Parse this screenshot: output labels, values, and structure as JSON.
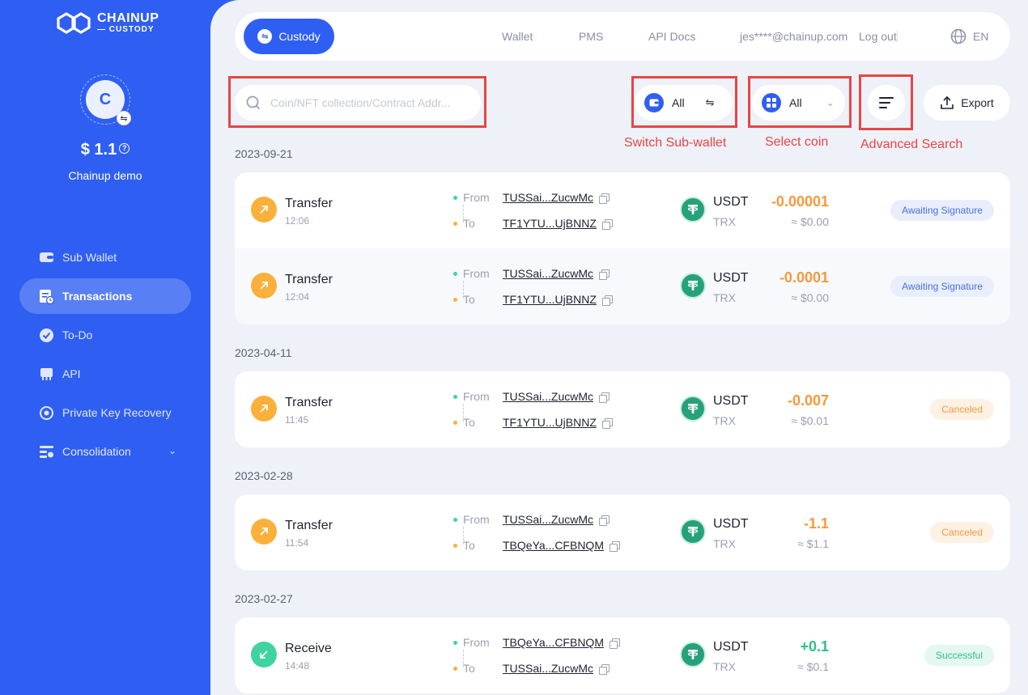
{
  "brand": {
    "name": "CHAINUP",
    "sub": "— CUSTODY"
  },
  "account": {
    "avatar_letter": "C",
    "balance": "$ 1.1",
    "name": "Chainup demo"
  },
  "nav": [
    {
      "label": "Sub Wallet",
      "icon": "wallet-icon"
    },
    {
      "label": "Transactions",
      "icon": "transactions-icon",
      "active": true
    },
    {
      "label": "To-Do",
      "icon": "check-circle-icon"
    },
    {
      "label": "API",
      "icon": "api-icon"
    },
    {
      "label": "Private Key Recovery",
      "icon": "key-recovery-icon"
    },
    {
      "label": "Consolidation",
      "icon": "consolidation-icon",
      "has_chevron": true
    }
  ],
  "topbar": {
    "custody_label": "Custody",
    "links": [
      "Wallet",
      "PMS",
      "API Docs"
    ],
    "email": "jes****@chainup.com",
    "logout": "Log out",
    "lang": "EN"
  },
  "toolbar": {
    "search_placeholder": "Coin/NFT collection/Contract Addr...",
    "subwallet_value": "All",
    "coin_value": "All",
    "export_label": "Export"
  },
  "annotations": {
    "subwallet": "Switch Sub-wallet",
    "coin": "Select coin",
    "advanced": "Advanced Search",
    "color": "#e54646"
  },
  "groups": [
    {
      "date": "2023-09-21",
      "rows": [
        {
          "type": "Transfer",
          "time": "12:06",
          "direction": "out",
          "from_label": "From",
          "from": "TUSSai...ZucwMc",
          "to_label": "To",
          "to": "TF1YTU...UjBNNZ",
          "coin": "USDT",
          "chain": "TRX",
          "amount": "-0.00001",
          "usd": "≈ $0.00",
          "status": "Awaiting Signature",
          "status_kind": "await"
        },
        {
          "type": "Transfer",
          "time": "12:04",
          "direction": "out",
          "from_label": "From",
          "from": "TUSSai...ZucwMc",
          "to_label": "To",
          "to": "TF1YTU...UjBNNZ",
          "coin": "USDT",
          "chain": "TRX",
          "amount": "-0.0001",
          "usd": "≈ $0.00",
          "status": "Awaiting Signature",
          "status_kind": "await"
        }
      ]
    },
    {
      "date": "2023-04-11",
      "rows": [
        {
          "type": "Transfer",
          "time": "11:45",
          "direction": "out",
          "from_label": "From",
          "from": "TUSSai...ZucwMc",
          "to_label": "To",
          "to": "TF1YTU...UjBNNZ",
          "coin": "USDT",
          "chain": "TRX",
          "amount": "-0.007",
          "usd": "≈ $0.01",
          "status": "Canceled",
          "status_kind": "cancel"
        }
      ]
    },
    {
      "date": "2023-02-28",
      "rows": [
        {
          "type": "Transfer",
          "time": "11:54",
          "direction": "out",
          "from_label": "From",
          "from": "TUSSai...ZucwMc",
          "to_label": "To",
          "to": "TBQeYa...CFBNQM",
          "coin": "USDT",
          "chain": "TRX",
          "amount": "-1.1",
          "usd": "≈ $1.1",
          "status": "Canceled",
          "status_kind": "cancel"
        }
      ]
    },
    {
      "date": "2023-02-27",
      "rows": [
        {
          "type": "Receive",
          "time": "14:48",
          "direction": "in",
          "from_label": "From",
          "from": "TBQeYa...CFBNQM",
          "to_label": "To",
          "to": "TUSSai...ZucwMc",
          "coin": "USDT",
          "chain": "TRX",
          "amount": "+0.1",
          "usd": "≈ $0.1",
          "status": "Successful",
          "status_kind": "success"
        }
      ]
    }
  ]
}
